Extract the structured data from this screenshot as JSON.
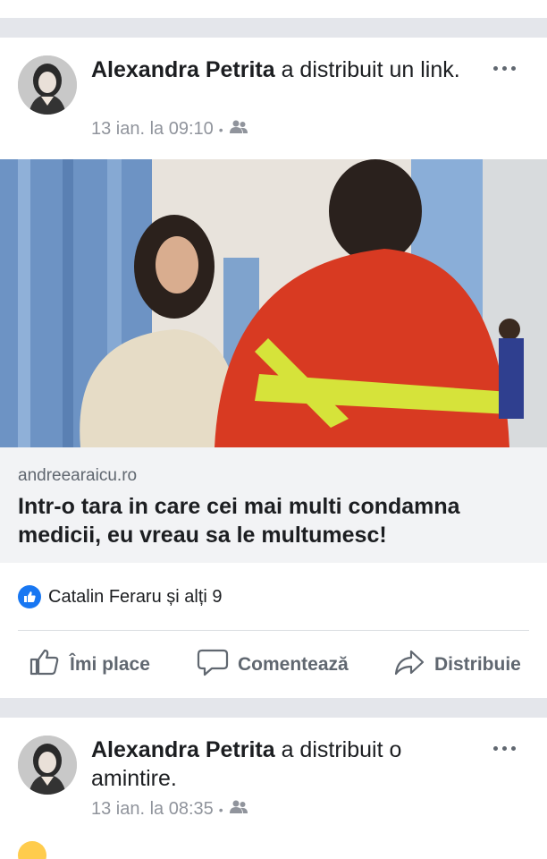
{
  "posts": [
    {
      "author": "Alexandra Petrita",
      "action_text": " a distribuit un link.",
      "time": "13 ian. la 09:10",
      "link": {
        "domain": "andreearaicu.ro",
        "title": "Intr-o tara in care cei mai multi condamna medicii, eu vreau sa le multumesc!"
      },
      "reactions_text": "Catalin Feraru și alți 9",
      "actions": {
        "like": "Îmi place",
        "comment": "Comentează",
        "share": "Distribuie"
      }
    },
    {
      "author": "Alexandra Petrita",
      "action_text": " a distribuit o amintire.",
      "time": "13 ian. la 08:35"
    }
  ],
  "colors": {
    "accent": "#1877f2",
    "meta_gray": "#90949c",
    "separator": "#e4e6eb"
  },
  "icons": [
    "friends-audience-icon",
    "more-options-icon",
    "like-icon",
    "comment-icon",
    "share-icon",
    "like-reaction-icon"
  ]
}
